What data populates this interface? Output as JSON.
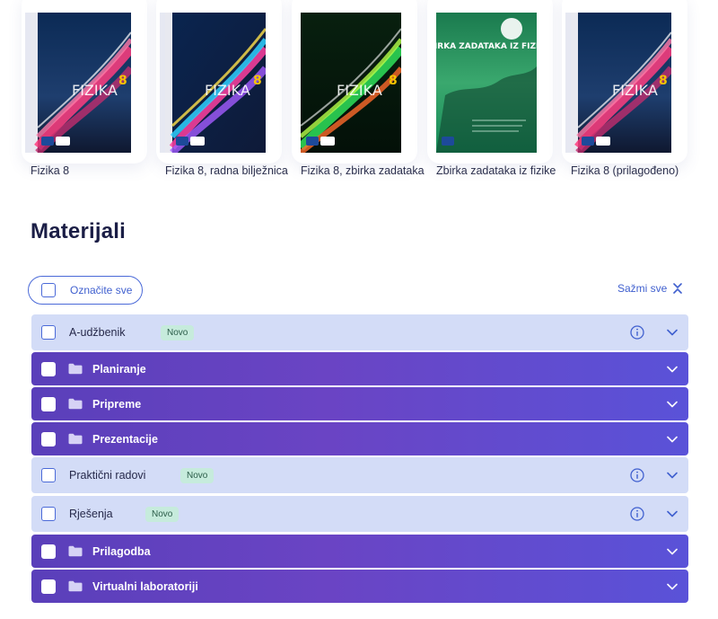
{
  "books": [
    {
      "title": "Fizika 8",
      "cover_text": "FIZIKA",
      "cover_num": "8",
      "theme": "pink"
    },
    {
      "title": "Fizika 8, radna bilježnica",
      "cover_text": "FIZIKA",
      "cover_num": "8",
      "theme": "rainbow"
    },
    {
      "title": "Fizika 8, zbirka zadataka",
      "cover_text": "FIZIKA",
      "cover_num": "8",
      "theme": "green"
    },
    {
      "title": "Zbirka zadataka iz fizike",
      "cover_text": "ZBIRKA ZADATAKA IZ FIZIKE",
      "cover_num": "",
      "theme": "teal"
    },
    {
      "title": "Fizika 8 (prilagođeno)",
      "cover_text": "FIZIKA",
      "cover_num": "8",
      "theme": "pink"
    }
  ],
  "materials": {
    "heading": "Materijali",
    "select_all_label": "Označite sve",
    "collapse_all_label": "Sažmi sve",
    "rows": [
      {
        "label": "A-udžbenik",
        "style": "light",
        "badge": "Novo",
        "info": true
      },
      {
        "label": "Planiranje",
        "style": "dark",
        "folder": true
      },
      {
        "label": "Pripreme",
        "style": "dark",
        "folder": true
      },
      {
        "label": "Prezentacije",
        "style": "dark",
        "folder": true
      },
      {
        "label": "Praktični radovi",
        "style": "light",
        "badge": "Novo",
        "info": true
      },
      {
        "label": "Rješenja",
        "style": "light",
        "badge": "Novo",
        "info": true
      },
      {
        "label": "Prilagodba",
        "style": "dark",
        "folder": true
      },
      {
        "label": "Virtualni laboratoriji",
        "style": "dark",
        "folder": true
      }
    ]
  },
  "colors": {
    "accent": "#4060cf",
    "row_light": "#d3dcf7",
    "row_dark": "#5a3fba",
    "badge_bg": "#c6ebdc",
    "heading": "#1b1e46"
  },
  "icons": {
    "checkbox": "checkbox-icon",
    "folder": "folder-icon",
    "info": "info-icon",
    "expand": "chevron-down-icon",
    "collapse_all": "collapse-all-icon"
  }
}
